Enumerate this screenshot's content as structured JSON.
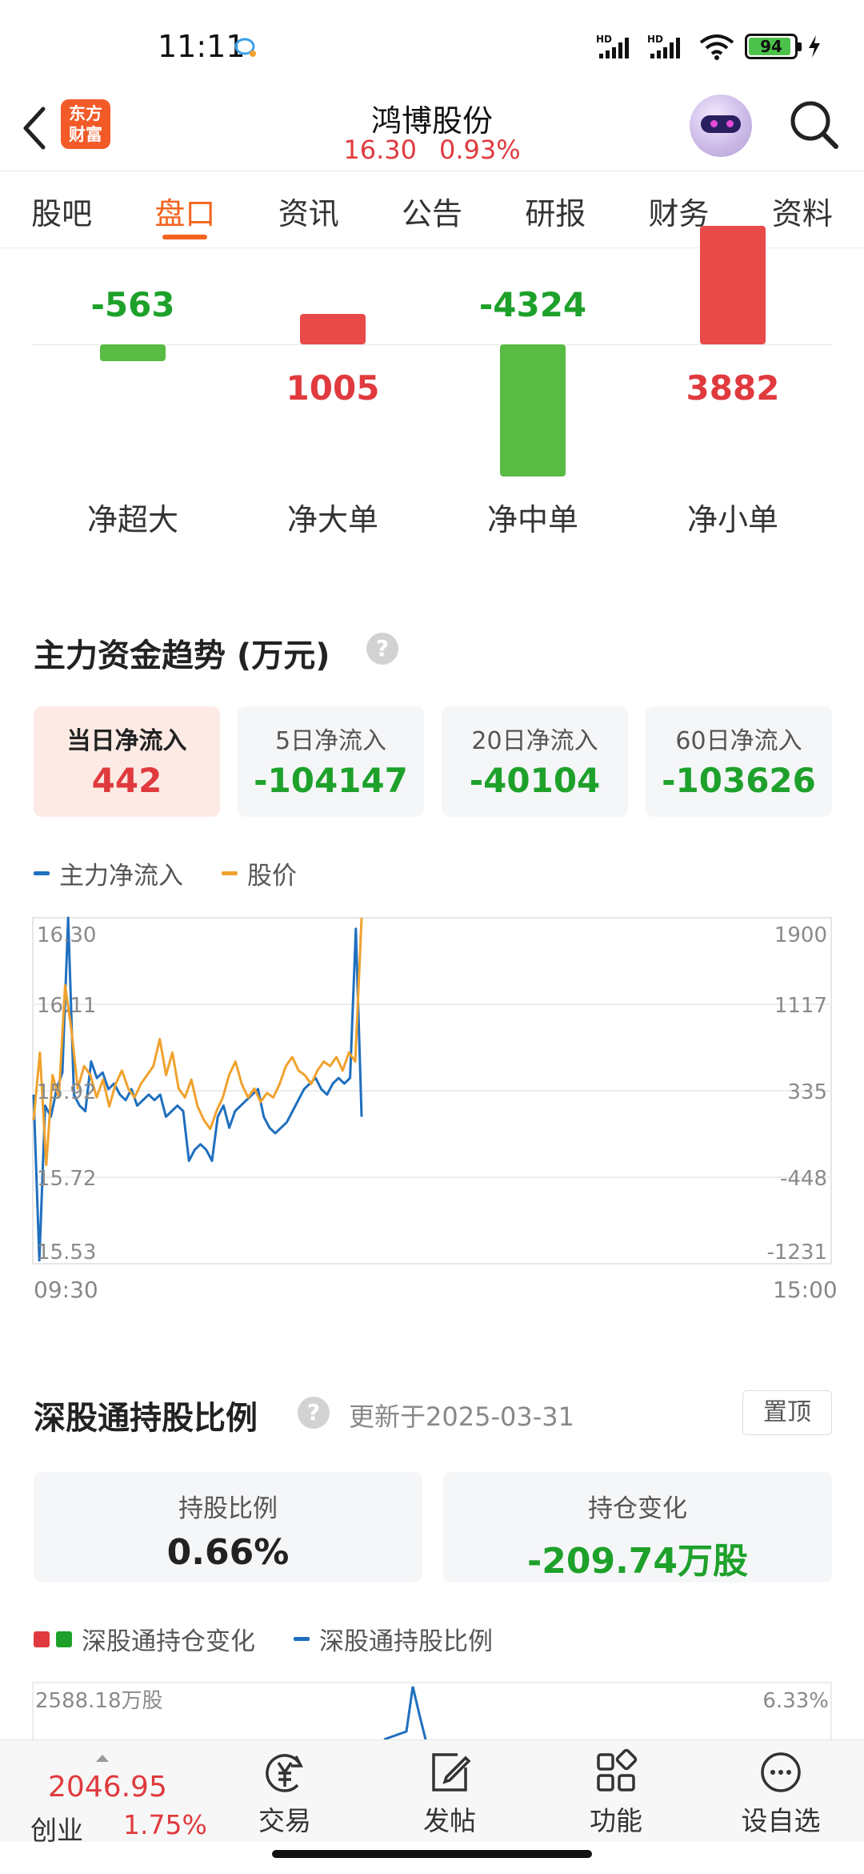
{
  "status_bar": {
    "time": "11:11",
    "battery": "94"
  },
  "header": {
    "logo_line1": "东方",
    "logo_line2": "财富",
    "stock_name": "鸿博股份",
    "price": "16.30",
    "change_pct": "0.93%"
  },
  "tabs": [
    "股吧",
    "盘口",
    "资讯",
    "公告",
    "研报",
    "财务",
    "资料"
  ],
  "active_tab": "盘口",
  "net_flow": {
    "items": [
      {
        "label": "净超大",
        "value": "-563",
        "amount": -563
      },
      {
        "label": "净大单",
        "value": "1005",
        "amount": 1005
      },
      {
        "label": "净中单",
        "value": "-4324",
        "amount": -4324
      },
      {
        "label": "净小单",
        "value": "3882",
        "amount": 3882
      }
    ],
    "colors": {
      "positive": "#e84a4a",
      "negative": "#5abb44"
    }
  },
  "main_trend": {
    "title": "主力资金趋势 (万元)",
    "help": "?",
    "cards": [
      {
        "label": "当日净流入",
        "value": "442"
      },
      {
        "label": "5日净流入",
        "value": "-104147"
      },
      {
        "label": "20日净流入",
        "value": "-40104"
      },
      {
        "label": "60日净流入",
        "value": "-103626"
      }
    ],
    "legend": [
      {
        "label": "主力净流入",
        "color": "#1f6fbf"
      },
      {
        "label": "股价",
        "color": "#f0a22e"
      }
    ],
    "time_start": "09:30",
    "time_end": "15:00"
  },
  "chart_data": {
    "type": "line",
    "x_start": "09:30",
    "x_end": "15:00",
    "y_left_ticks": [
      "16.30",
      "16.11",
      "15.92",
      "15.72",
      "15.53"
    ],
    "y_right_ticks": [
      "1900",
      "1117",
      "335",
      "-448",
      "-1231"
    ],
    "y_left_range": [
      15.53,
      16.3
    ],
    "y_right_range": [
      -1231,
      1900
    ],
    "series": [
      {
        "name": "主力净流入",
        "color": "#1f6fbf",
        "axis": "right",
        "values": [
          300,
          -1200,
          200,
          100,
          350,
          500,
          1900,
          300,
          200,
          150,
          600,
          450,
          500,
          350,
          400,
          300,
          250,
          350,
          200,
          250,
          300,
          250,
          300,
          100,
          150,
          200,
          150,
          -300,
          -200,
          -150,
          -200,
          -300,
          100,
          200,
          0,
          150,
          200,
          250,
          300,
          350,
          100,
          0,
          -50,
          0,
          50,
          150,
          250,
          350,
          400,
          450,
          350,
          300,
          400,
          450,
          400,
          450,
          1800,
          100
        ]
      },
      {
        "name": "股价",
        "color": "#f0a22e",
        "axis": "left",
        "values": [
          15.85,
          16.0,
          15.75,
          15.95,
          15.9,
          16.15,
          16.05,
          15.92,
          15.97,
          15.95,
          15.9,
          15.94,
          15.88,
          15.93,
          15.96,
          15.92,
          15.9,
          15.93,
          15.95,
          15.97,
          16.03,
          15.95,
          16.0,
          15.92,
          15.9,
          15.94,
          15.88,
          15.85,
          15.83,
          15.87,
          15.9,
          15.95,
          15.98,
          15.93,
          15.9,
          15.92,
          15.89,
          15.91,
          15.9,
          15.93,
          15.97,
          15.99,
          15.96,
          15.95,
          15.93,
          15.96,
          15.98,
          15.97,
          15.99,
          15.96,
          16.0,
          15.98,
          16.3
        ]
      }
    ]
  },
  "hk_connect": {
    "title": "深股通持股比例",
    "help": "?",
    "updated": "更新于2025-03-31",
    "pin_label": "置顶",
    "cards": [
      {
        "label": "持股比例",
        "value": "0.66%"
      },
      {
        "label": "持仓变化",
        "value": "-209.74万股"
      }
    ],
    "legend": [
      {
        "label": "深股通持仓变化"
      },
      {
        "label": "深股通持股比例"
      }
    ],
    "axis_left_top": "2588.18万股",
    "axis_right_top": "6.33%"
  },
  "bottom_bar": {
    "index_value": "2046.95",
    "index_name": "创业",
    "index_change": "1.75%",
    "nav": [
      "交易",
      "发帖",
      "功能",
      "设自选"
    ]
  }
}
